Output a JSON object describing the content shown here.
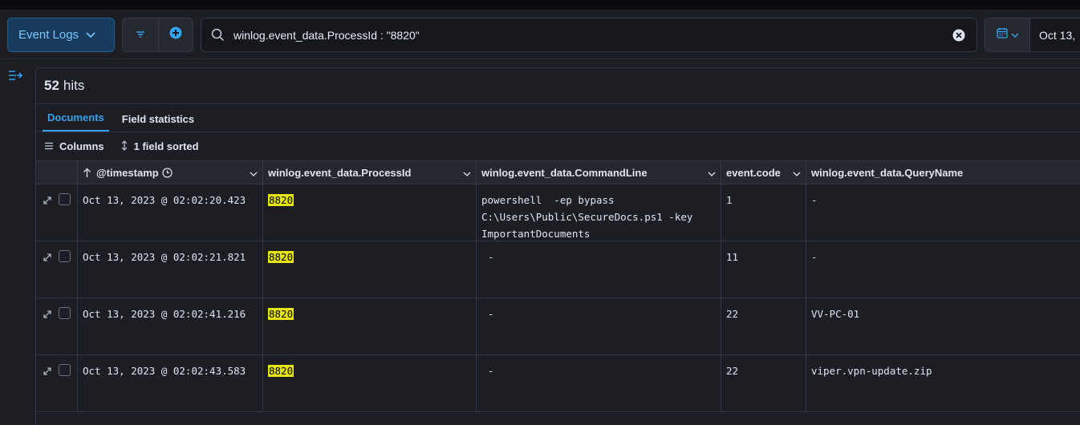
{
  "toolbar": {
    "data_view_label": "Event Logs",
    "query": "winlog.event_data.ProcessId : \"8820\"",
    "date_label": "Oct 13,"
  },
  "results": {
    "hits_count": "52",
    "hits_label": "hits"
  },
  "tabs": [
    {
      "label": "Documents",
      "active": true
    },
    {
      "label": "Field statistics",
      "active": false
    }
  ],
  "grid_controls": {
    "columns_label": "Columns",
    "sorted_label": "1 field sorted"
  },
  "columns": [
    {
      "label": "@timestamp"
    },
    {
      "label": "winlog.event_data.ProcessId"
    },
    {
      "label": "winlog.event_data.CommandLine"
    },
    {
      "label": "event.code"
    },
    {
      "label": "winlog.event_data.QueryName"
    }
  ],
  "rows": [
    {
      "timestamp": "Oct 13, 2023 @ 02:02:20.423",
      "process_id": "8820",
      "command_line": "powershell  -ep bypass\nC:\\Users\\Public\\SecureDocs.ps1 -key\nImportantDocuments",
      "event_code": "1",
      "query_name": "-"
    },
    {
      "timestamp": "Oct 13, 2023 @ 02:02:21.821",
      "process_id": "8820",
      "command_line": "-",
      "event_code": "11",
      "query_name": "-"
    },
    {
      "timestamp": "Oct 13, 2023 @ 02:02:41.216",
      "process_id": "8820",
      "command_line": "-",
      "event_code": "22",
      "query_name": "VV-PC-01"
    },
    {
      "timestamp": "Oct 13, 2023 @ 02:02:43.583",
      "process_id": "8820",
      "command_line": "-",
      "event_code": "22",
      "query_name": "viper.vpn-update.zip"
    }
  ],
  "colors": {
    "accent": "#36a2ef",
    "highlight": "#e6e600",
    "background": "#1d1e24"
  }
}
